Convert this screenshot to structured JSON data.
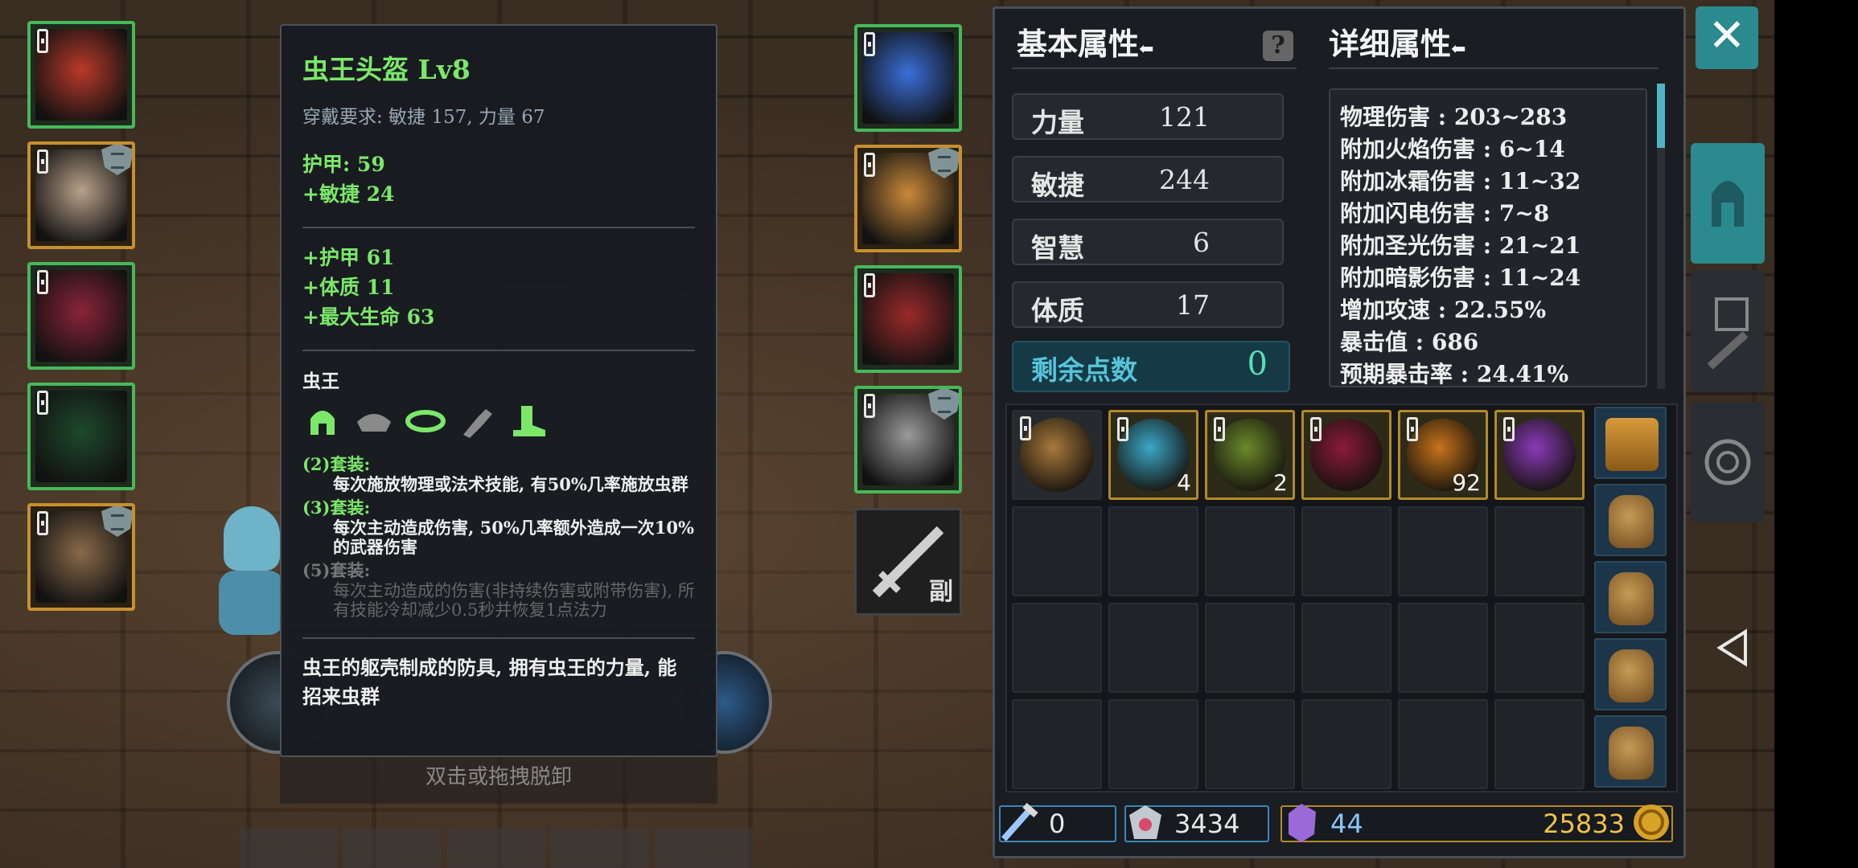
{
  "equipment_left": [
    {
      "name": "red-helmet",
      "color": "#b93a2a",
      "rarity": "green",
      "shield": false
    },
    {
      "name": "armor",
      "color": "#b9a28a",
      "rarity": "gold",
      "shield": true
    },
    {
      "name": "red-robe",
      "color": "#8a2438",
      "rarity": "green",
      "shield": false
    },
    {
      "name": "green-ring",
      "color": "#1e4a2a",
      "rarity": "green",
      "shield": false
    },
    {
      "name": "claw",
      "color": "#8a6a4a",
      "rarity": "gold",
      "shield": true
    }
  ],
  "equipment_right": [
    {
      "name": "blue-crystal",
      "color": "#3a6fd8",
      "rarity": "green",
      "shield": false
    },
    {
      "name": "gauntlet",
      "color": "#c98a3a",
      "rarity": "gold",
      "shield": true
    },
    {
      "name": "red-boots",
      "color": "#9a2a2a",
      "rarity": "green",
      "shield": false
    },
    {
      "name": "silver-ring",
      "color": "#9a9a9a",
      "rarity": "green",
      "shield": true
    }
  ],
  "weapon_slot": {
    "label": "副"
  },
  "tooltip": {
    "title": "虫王头盔  Lv8",
    "requirement": "穿戴要求:   敏捷 157, 力量 67",
    "base": [
      "护甲:  59",
      "+敏捷  24"
    ],
    "bonus": [
      "+护甲  61",
      "+体质  11",
      "+最大生命  63"
    ],
    "set_name": "虫王",
    "set_icons": [
      "helmet-icon",
      "shoulder-icon",
      "belt-icon",
      "glove-icon",
      "boot-icon"
    ],
    "set_bonuses": [
      {
        "header": "(2)套装:",
        "desc": "每次施放物理或法术技能, 有50%几率施放虫群",
        "active": true
      },
      {
        "header": "(3)套装:",
        "desc": "每次主动造成伤害, 50%几率额外造成一次10%的武器伤害",
        "active": true
      },
      {
        "header": "(5)套装:",
        "desc": "每次主动造成的伤害(非持续伤害或附带伤害), 所有技能冷却减少0.5秒并恢复1点法力",
        "active": false
      }
    ],
    "description": "虫王的躯壳制成的防具, 拥有虫王的力量, 能招来虫群",
    "unequip_hint": "双击或拖拽脱卸"
  },
  "basic_attrs": {
    "header": "基本属性",
    "stats": [
      {
        "label": "力量",
        "value": "121"
      },
      {
        "label": "敏捷",
        "value": "244"
      },
      {
        "label": "智慧",
        "value": "6"
      },
      {
        "label": "体质",
        "value": "17"
      }
    ],
    "remaining_label": "剩余点数",
    "remaining_value": "0"
  },
  "detail_attrs": {
    "header": "详细属性",
    "rows": [
      "物理伤害 : 203~283",
      "附加火焰伤害 : 6~14",
      "附加冰霜伤害 : 11~32",
      "附加闪电伤害 : 7~8",
      "附加圣光伤害 : 21~21",
      "附加暗影伤害 : 11~24",
      "增加攻速 : 22.55%",
      "暴击值 : 686",
      "预期暴击率 : 24.41%"
    ]
  },
  "inventory": [
    {
      "name": "backpack",
      "color": "#a8793c",
      "count": "",
      "gold": false
    },
    {
      "name": "blue-scroll",
      "color": "#3aa8c8",
      "count": "4",
      "gold": true
    },
    {
      "name": "green-scroll",
      "color": "#6a8a2a",
      "count": "2",
      "gold": true
    },
    {
      "name": "red-orb",
      "color": "#8a1a3a",
      "count": "",
      "gold": true
    },
    {
      "name": "spiral-orb",
      "color": "#c8741a",
      "count": "92",
      "gold": true
    },
    {
      "name": "purple-potion",
      "color": "#8a3ab8",
      "count": "",
      "gold": true
    }
  ],
  "currency": {
    "tools": "0",
    "gems": "3434",
    "crystals": "44",
    "gold": "25833"
  },
  "icons": {
    "close": "close-icon",
    "help": "help-icon",
    "side_tabs": [
      "helmet-tab-icon",
      "tools-tab-icon",
      "target-tab-icon"
    ],
    "back": "back-icon"
  }
}
